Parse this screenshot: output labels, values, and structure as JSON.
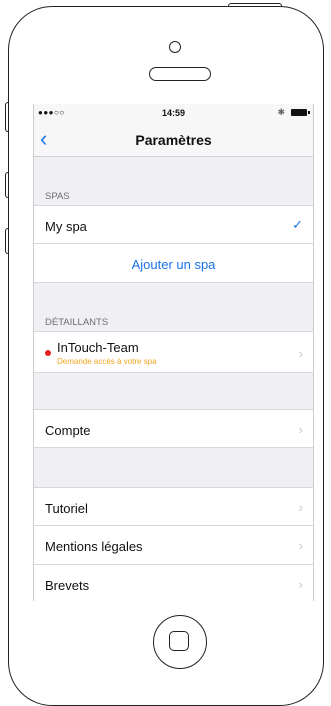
{
  "status": {
    "signal": "●●●○○",
    "time": "14:59",
    "bluetooth": "✱"
  },
  "nav": {
    "back": "‹",
    "title": "Paramètres"
  },
  "spas": {
    "header": "SPAS",
    "items": [
      {
        "label": "My spa",
        "checked": true
      }
    ],
    "add_label": "Ajouter un spa"
  },
  "dealers": {
    "header": "DÉTAILLANTS",
    "items": [
      {
        "name": "InTouch-Team",
        "subtitle": "Demande accès à votre spa"
      }
    ]
  },
  "account": {
    "label": "Compte"
  },
  "info": {
    "items": [
      {
        "label": "Tutoriel"
      },
      {
        "label": "Mentions légales"
      },
      {
        "label": "Brevets"
      }
    ]
  },
  "colors": {
    "accent": "#1a73e8",
    "warning": "#f5a623",
    "dot": "#e02020"
  }
}
